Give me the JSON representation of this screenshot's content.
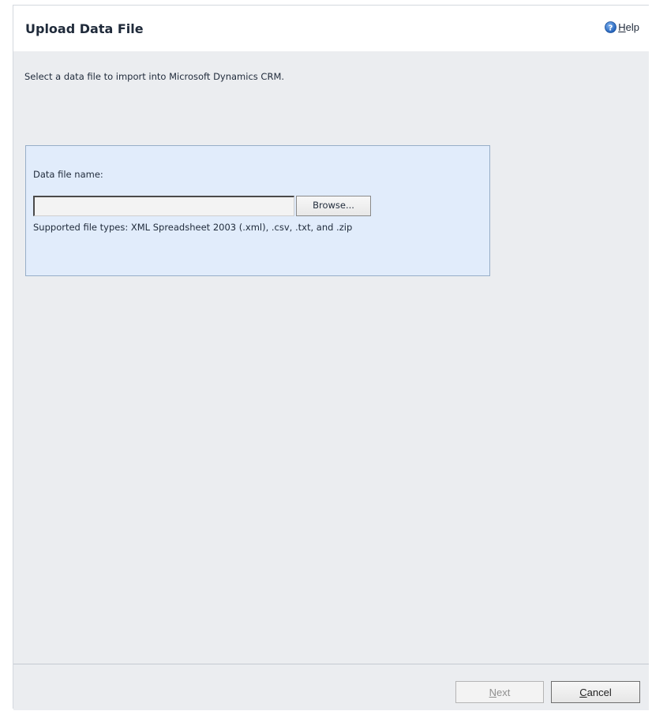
{
  "dialog": {
    "title": "Upload Data File",
    "help": {
      "label": "Help",
      "icon": "help-icon"
    },
    "instruction": "Select a data file to import into Microsoft Dynamics CRM."
  },
  "file_panel": {
    "label": "Data file name:",
    "input_value": "",
    "browse_label": "Browse...",
    "supported_types": "Supported file types: XML Spreadsheet 2003 (.xml), .csv, .txt, and .zip"
  },
  "footer": {
    "next_label": "Next",
    "next_enabled": false,
    "cancel_label": "Cancel"
  },
  "colors": {
    "dialog_background": "#ebedf0",
    "panel_background": "#e1ecfb",
    "panel_border": "#97aec8",
    "help_icon": "#2f6fc4",
    "text": "#1f2a3a"
  }
}
